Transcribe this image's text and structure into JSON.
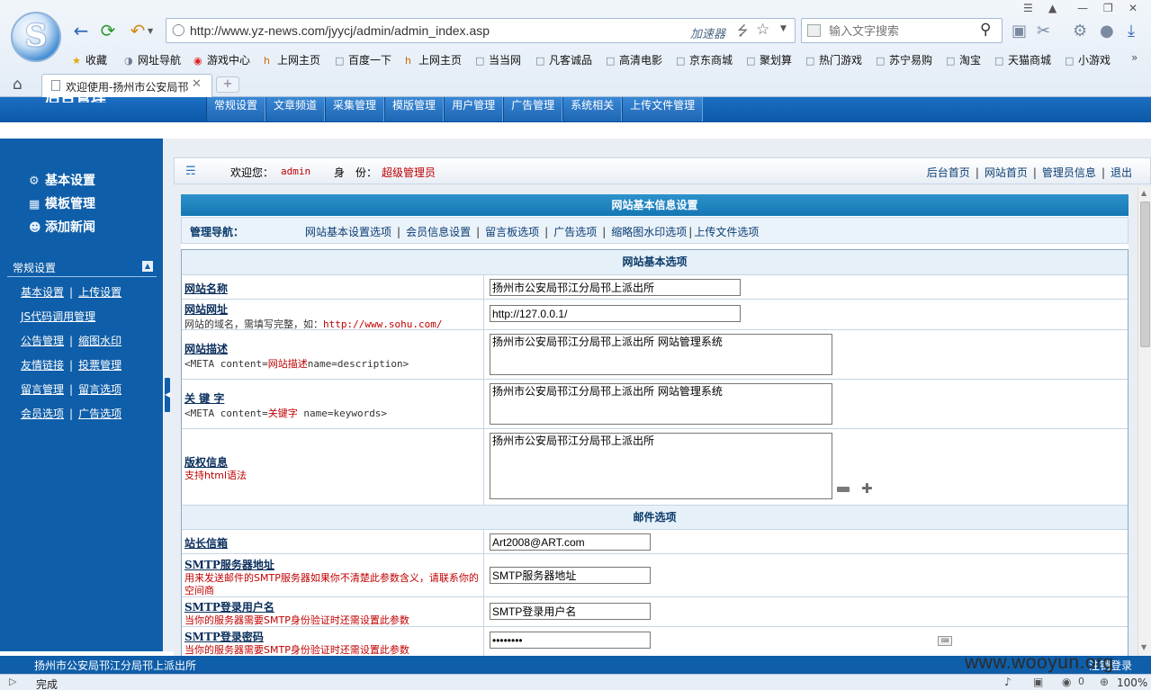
{
  "browser": {
    "url": "http://www.yz-news.com/jyycj/admin/admin_index.asp",
    "accelerator_label": "加速器",
    "search_placeholder": "输入文字搜索",
    "bookmarks": [
      "收藏",
      "网址导航",
      "游戏中心",
      "上网主页",
      "百度一下",
      "上网主页",
      "当当网",
      "凡客诚品",
      "高清电影",
      "京东商城",
      "聚划算",
      "热门游戏",
      "苏宁易购",
      "淘宝",
      "天猫商城",
      "小游戏"
    ],
    "tab_title": "欢迎使用-扬州市公安局邗江分局邗上派出所",
    "status_text": "完成",
    "status_count": "0",
    "zoom": "100%"
  },
  "site": {
    "header_title": "后台管理",
    "top_menu": [
      "常规设置",
      "文章频道",
      "采集管理",
      "模版管理",
      "用户管理",
      "广告管理",
      "系统相关",
      "上传文件管理"
    ],
    "footer_text": "扬州市公安局邗江分局邗上派出所",
    "footer_right": "注销登录",
    "watermark": "www.wooyun.org"
  },
  "sidebar": {
    "top_links": [
      "基本设置",
      "模板管理",
      "添加新闻"
    ],
    "section_title": "常规设置",
    "rows": [
      [
        "基本设置",
        "上传设置"
      ],
      [
        "JS代码调用管理"
      ],
      [
        "公告管理",
        "缩图水印"
      ],
      [
        "友情链接",
        "投票管理"
      ],
      [
        "留言管理",
        "留言选项"
      ],
      [
        "会员选项",
        "广告选项"
      ]
    ]
  },
  "welcome": {
    "greeting": "欢迎您：",
    "username": "admin",
    "identity_label": "身　份：",
    "identity_value": "超级管理员",
    "links": [
      "后台首页",
      "网站首页",
      "管理员信息",
      "退出"
    ]
  },
  "panel": {
    "title": "网站基本信息设置",
    "nav_label": "管理导航：",
    "nav_links": [
      "网站基本设置选项",
      "会员信息设置",
      "留言板选项",
      "广告选项",
      "缩略图水印选项",
      "上传文件选项"
    ],
    "section_basic": "网站基本选项",
    "section_mail": "邮件选项",
    "fields": {
      "site_name": {
        "label": "网站名称",
        "value": "扬州市公安局邗江分局邗上派出所"
      },
      "site_url": {
        "label": "网站网址",
        "note": "网站的域名，需填写完整，如：",
        "note_example": "http://www.sohu.com/",
        "value": "http://127.0.0.1/"
      },
      "site_desc": {
        "label": "网站描述",
        "note_pre": "<META content=",
        "note_mid": "网站描述",
        "note_post": "name=description>",
        "value": "扬州市公安局邗江分局邗上派出所 网站管理系统"
      },
      "keywords": {
        "label": "关 键 字",
        "note_pre": "<META content=",
        "note_mid": "关键字",
        "note_post": " name=keywords>",
        "value": "扬州市公安局邗江分局邗上派出所 网站管理系统"
      },
      "copyright": {
        "label": "版权信息",
        "note": "支持html语法",
        "value": "扬州市公安局邗江分局邗上派出所"
      },
      "admin_email": {
        "label": "站长信箱",
        "value": "Art2008@ART.com"
      },
      "smtp_server": {
        "label": "SMTP服务器地址",
        "note": "用来发送邮件的SMTP服务器如果你不清楚此参数含义，请联系你的空间商",
        "value": "SMTP服务器地址"
      },
      "smtp_user": {
        "label": "SMTP登录用户名",
        "note": "当你的服务器需要SMTP身份验证时还需设置此参数",
        "value": "SMTP登录用户名"
      },
      "smtp_pass": {
        "label": "SMTP登录密码",
        "note": "当你的服务器需要SMTP身份验证时还需设置此参数",
        "value": "password"
      }
    }
  }
}
